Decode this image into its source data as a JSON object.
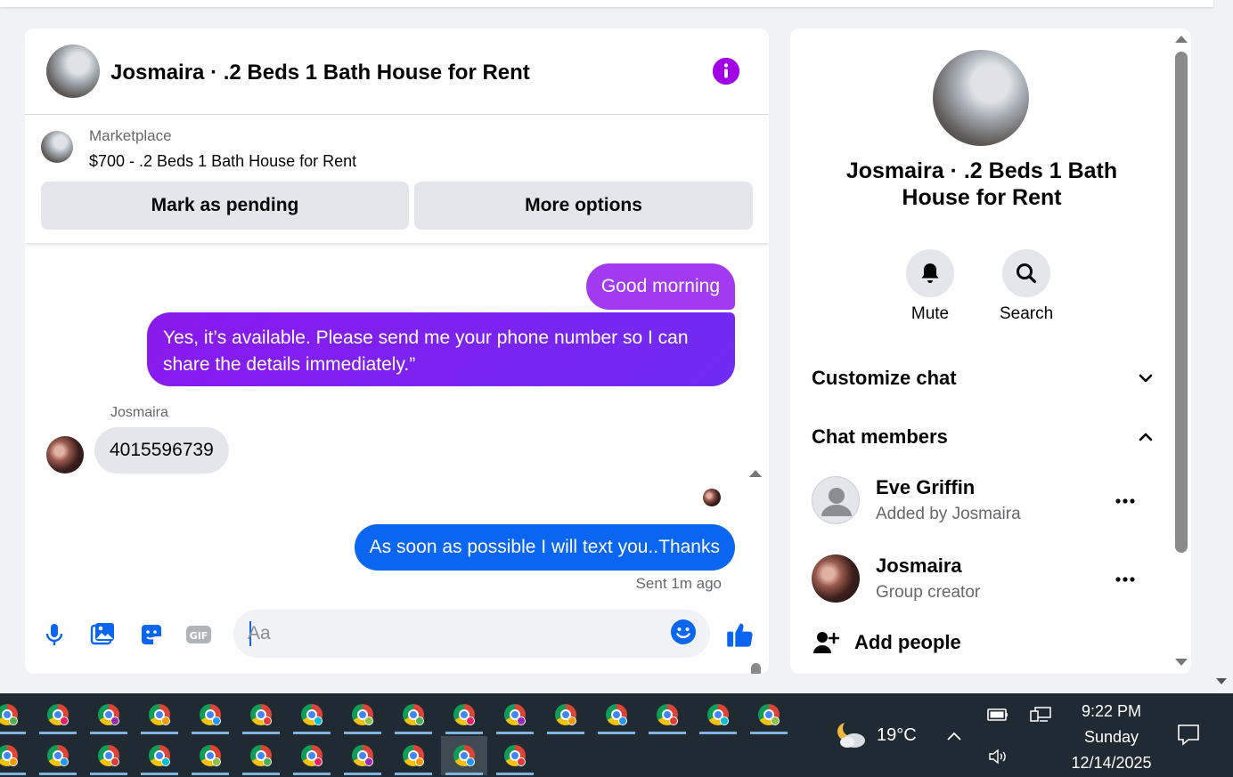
{
  "chat": {
    "title": "Josmaira · .2 Beds 1 Bath House for Rent",
    "marketplace": {
      "label": "Marketplace",
      "listing": "$700 - .2 Beds 1 Bath House for Rent",
      "mark_pending": "Mark as pending",
      "more_options": "More options"
    },
    "messages": [
      {
        "text": "Good morning"
      },
      {
        "text": "Yes, it’s available. Please send me your phone number so I can share the details immediately.”"
      },
      {
        "sender": "Josmaira",
        "text": "4015596739"
      },
      {
        "text": "As soon as possible I will text you..Thanks"
      }
    ],
    "sent_status": "Sent 1m ago",
    "composer": {
      "placeholder": "Aa"
    }
  },
  "info": {
    "title": "Josmaira · .2 Beds 1 Bath House for Rent",
    "actions": {
      "mute": "Mute",
      "search": "Search"
    },
    "customize_chat": "Customize chat",
    "chat_members": "Chat members",
    "members": [
      {
        "name": "Eve Griffin",
        "sub": "Added by Josmaira"
      },
      {
        "name": "Josmaira",
        "sub": "Group creator"
      }
    ],
    "add_people": "Add people"
  },
  "taskbar": {
    "temperature": "19°C",
    "time": "9:22 PM",
    "day": "Sunday",
    "date": "12/14/2025"
  },
  "colors": {
    "accent_purple": "#a200e8",
    "outgoing_blue": "#0a66f0",
    "outgoing_purple": "#a23bf0",
    "taskbar": "#1f2a33"
  }
}
